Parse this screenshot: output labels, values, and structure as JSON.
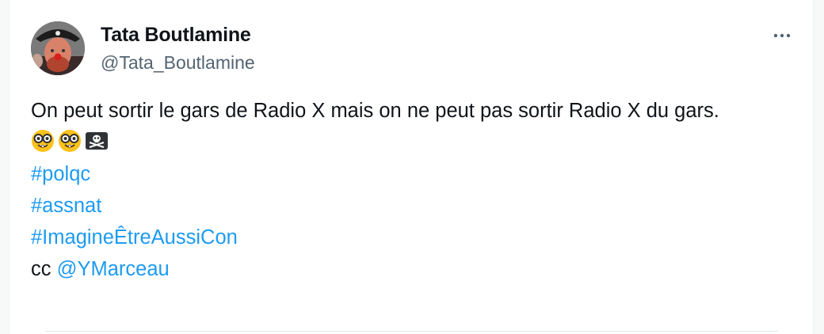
{
  "tweet": {
    "author_name": "Tata Boutlamine",
    "author_handle": "@Tata_Boutlamine",
    "text": "On peut sortir le gars de Radio X mais on ne peut pas sortir Radio X du gars.",
    "emojis": [
      "nerd-face-icon",
      "nerd-face-icon",
      "skull-crossbones-icon"
    ],
    "hashtags": [
      "#polqc",
      "#assnat",
      "#ImagineÊtreAussiCon"
    ],
    "cc_prefix": "cc",
    "mention": "@YMarceau"
  },
  "colors": {
    "link": "#1d9bf0",
    "text": "#0f1419",
    "secondary": "#536471"
  },
  "icons": {
    "more": "more-options-icon",
    "avatar": "pirate-avatar"
  }
}
